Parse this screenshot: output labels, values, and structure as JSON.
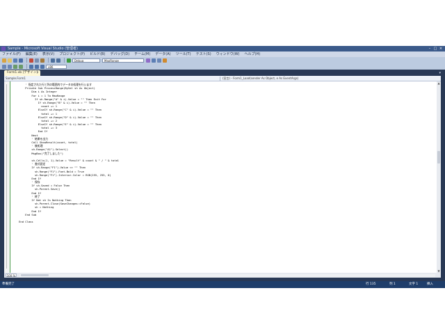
{
  "window": {
    "title": "Sample - Microsoft Visual Studio (管理者)",
    "buttons": {
      "minimize": "–",
      "maximize": "□",
      "close": "×"
    }
  },
  "menu": {
    "items": [
      "ファイル(F)",
      "編集(E)",
      "表示(V)",
      "プロジェクト(P)",
      "ビルド(B)",
      "デバッグ(D)",
      "チーム(M)",
      "データ(A)",
      "ツール(T)",
      "テスト(S)",
      "ウィンドウ(W)",
      "ヘルプ(H)"
    ]
  },
  "toolbar": {
    "config_combo": "Debug",
    "platform_combo": "x86",
    "find_combo": "MaxRange"
  },
  "tabs": {
    "active_label": "Form1.vb [デザイン]",
    "close": "×",
    "dropdown": "▾"
  },
  "navbar": {
    "left": "Sample.Form1",
    "right": "(宣言) - Form1_Load(sender As Object, e As EventArgs)"
  },
  "code": {
    "lines": [
      "        ' 指定された行と列の範囲内でデータの処理を行います",
      "        Private Sub ProcessRange(ByVal sh As Object)",
      "            Dim i As Integer",
      "            For i = 1 To MaxRange",
      "              If sh.Range(\"A\" & i).Value = \"\" Then Exit For",
      "                If sh.Range(\"B\" & i).Value = \"\" Then",
      "                  count += 1",
      "                ElseIf sh.Range(\"C\" & i).Value = \"\" Then",
      "                  total += 1",
      "                ElseIf sh.Range(\"D\" & i).Value = \"\" Then",
      "                  total += 2",
      "                ElseIf sh.Range(\"E\" & i).Value = \"\" Then",
      "                  total += 3",
      "                End If",
      "            Next",
      "            ' 結果を出力",
      "            Call ShowResult(count, total)",
      "            ' 後処理",
      "            sh.Range(\"A1\").Select()",
      "            MsgBox(\"完了しました\")",
      "",
      "            sh.Cells(1, 1).Value = \"Result\" & count & \" / \" & total",
      "            ' 書式設定",
      "            If sh.Range(\"F1\").Value <> \"\" Then",
      "              sh.Range(\"F1\").Font.Bold = True",
      "              sh.Range(\"F1\").Interior.Color = RGB(255, 255, 0)",
      "            End If",
      "            ' 保存",
      "            If sh.Saved = False Then",
      "              sh.Parent.Save()",
      "            End If",
      "            ' 終了",
      "            If Not sh Is Nothing Then",
      "              sh.Parent.Close(SaveChanges:=False)",
      "              sh = Nothing",
      "            End If",
      "        End Sub",
      "",
      "    End Class"
    ]
  },
  "editor": {
    "zoom": "100 %"
  },
  "status": {
    "ready": "準備完了",
    "line": "行 135",
    "col": "列 1",
    "char": "文字 1",
    "mode": "挿入"
  }
}
